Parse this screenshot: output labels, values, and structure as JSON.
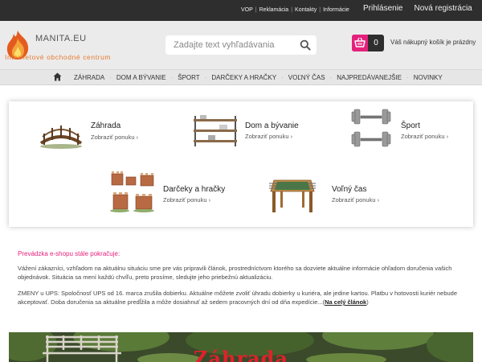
{
  "topbar": {
    "links": [
      "VOP",
      "Reklamácia",
      "Kontakty",
      "Informácie"
    ],
    "login": "Prihlásenie",
    "register": "Nová registrácia"
  },
  "header": {
    "logo_name": "MANITA.EU",
    "logo_tagline": "Internetové obchodné centrum",
    "search_placeholder": "Zadajte text vyhľadávania",
    "cart_count": "0",
    "cart_text": "Váš nákupný košík je prázdny"
  },
  "nav": {
    "items": [
      "ZÁHRADA",
      "DOM A BÝVANIE",
      "ŠPORT",
      "DARČEKY A HRAČKY",
      "VOĽNÝ ČAS",
      "NAJPREDÁVANEJŠIE",
      "NOVINKY"
    ]
  },
  "categories": [
    {
      "title": "Záhrada",
      "link": "Zobraziť ponuku",
      "icon": "garden-bridge"
    },
    {
      "title": "Dom a bývanie",
      "link": "Zobraziť ponuku",
      "icon": "shelf-rack"
    },
    {
      "title": "Šport",
      "link": "Zobraziť ponuku",
      "icon": "dumbbells"
    },
    {
      "title": "Darčeky a hračky",
      "link": "Zobraziť ponuku",
      "icon": "toy-castles"
    },
    {
      "title": "Voľný čas",
      "link": "Zobraziť ponuku",
      "icon": "foosball-table"
    }
  ],
  "info": {
    "heading": "Prevádzka e-shopu stále pokračuje:",
    "paragraph1": "Vážení zákazníci, vzhľadom na aktuálnu situáciu sme pre vás pripravili článok, prostredníctvom ktorého sa dozviete aktuálne informácie ohľadom doručenia vašich objednávok. Situácia sa mení každú chvíľu, preto prosíme, sledujte jeho priebežnú aktualizáciu.",
    "paragraph2": "ZMENY u UPS:  Spoločnosť UPS od 16. marca zrušila dobierku. Aktuálne môžete zvoliť úhradu dobierky u kuriéra, ale jedine kartou. Platbu v hotovosti kuriér nebude akceptovať. Doba doručenia sa aktuálne predĺžila a môže dosiahnuť až sedem pracovných dní od dňa expedície...(",
    "link": "Na celý článok",
    "close": ")"
  },
  "banner": {
    "title": "Záhrada"
  },
  "colors": {
    "accent": "#e5217c",
    "topbar": "#2e2e2e",
    "logo_orange": "#e77a2f"
  }
}
